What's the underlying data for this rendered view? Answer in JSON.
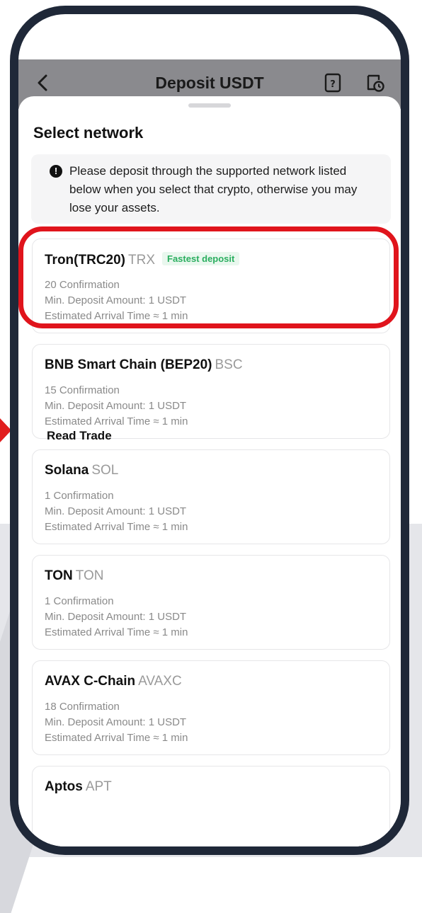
{
  "header": {
    "title": "Deposit USDT",
    "back_icon": "chevron-left-icon",
    "help_icon": "help-icon",
    "history_icon": "history-icon"
  },
  "sheet": {
    "title": "Select network",
    "notice": "Please deposit through the supported network listed below when you select that crypto, otherwise you may lose your assets.",
    "notice_icon": "!"
  },
  "networks": [
    {
      "name": "Tron(TRC20)",
      "code": "TRX",
      "badge": "Fastest deposit",
      "confirmations": "20 Confirmation",
      "min_deposit": "Min. Deposit Amount: 1 USDT",
      "arrival": "Estimated Arrival Time ≈ 1 min"
    },
    {
      "name": "BNB Smart Chain (BEP20)",
      "code": "BSC",
      "confirmations": "15 Confirmation",
      "min_deposit": "Min. Deposit Amount: 1 USDT",
      "arrival": "Estimated Arrival Time ≈ 1 min"
    },
    {
      "name": "Solana",
      "code": "SOL",
      "confirmations": "1 Confirmation",
      "min_deposit": "Min. Deposit Amount: 1 USDT",
      "arrival": "Estimated Arrival Time ≈ 1 min"
    },
    {
      "name": "TON",
      "code": "TON",
      "confirmations": "1 Confirmation",
      "min_deposit": "Min. Deposit Amount: 1 USDT",
      "arrival": "Estimated Arrival Time ≈ 1 min"
    },
    {
      "name": "AVAX C-Chain",
      "code": "AVAXC",
      "confirmations": "18 Confirmation",
      "min_deposit": "Min. Deposit Amount: 1 USDT",
      "arrival": "Estimated Arrival Time ≈ 1 min"
    },
    {
      "name": "Aptos",
      "code": "APT"
    }
  ],
  "overlay": {
    "watermark": "Read Trade",
    "highlight_color": "#e0141c",
    "arrow_color": "#e11d1d"
  },
  "colors": {
    "header_bg": "#8a8a8e",
    "badge_text": "#2aae5f",
    "badge_bg": "#e9f7ee",
    "phone_frame": "#1f2838"
  }
}
